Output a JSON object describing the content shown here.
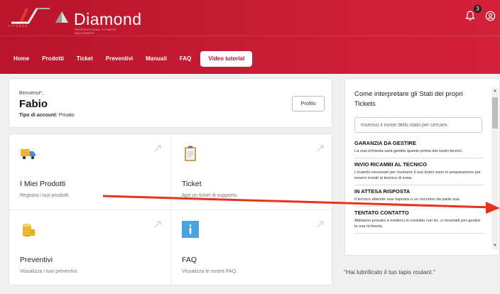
{
  "header": {
    "brand": "Diamond",
    "brand_sub": "PROFESSIONAL FITNESS EQUIPMENT",
    "logo_text": "FITNESS",
    "notifications_count": "3"
  },
  "nav": {
    "items": [
      {
        "label": "Home"
      },
      {
        "label": "Prodotti"
      },
      {
        "label": "Ticket"
      },
      {
        "label": "Preventivi"
      },
      {
        "label": "Manuali"
      },
      {
        "label": "FAQ"
      },
      {
        "label": "Video tutorial"
      }
    ],
    "active": "Video tutorial"
  },
  "welcome": {
    "greeting": "Benvenut*,",
    "name": "Fabio",
    "account_type_label": "Tipo di account:",
    "account_type_value": "Privato",
    "profile_button": "Profilo"
  },
  "tiles": [
    {
      "title": "I Miei Prodotti",
      "desc": "Registra i tuoi prodotti.",
      "icon": "truck-icon"
    },
    {
      "title": "Ticket",
      "desc": "Apri un ticket di supporto.",
      "icon": "clipboard-icon"
    },
    {
      "title": "Preventivi",
      "desc": "Visualizza i tuoi preventivi.",
      "icon": "coins-icon"
    },
    {
      "title": "FAQ",
      "desc": "Visualizza le nostre FAQ.",
      "icon": "info-icon"
    }
  ],
  "sidebar": {
    "title": "Come interpretare gli Stati dei propri Tickets",
    "search_placeholder": "Inserisci il nome dello stato per cercare.",
    "statuses": [
      {
        "title": "GARANZIA DA GESTIRE",
        "desc": "La sua richiesta sarà gestita quanto prima dai nostri tecnici."
      },
      {
        "title": "INVIO RICAMBI AL TECNICO",
        "desc": "I ricambi necessari per risolvere il suo ticket sono in preparazione per essere inviati al tecnico di zona."
      },
      {
        "title": "IN ATTESA RISPOSTA",
        "desc": "Il tecnico attende una risposta o un riscontro da parte sua."
      },
      {
        "title": "TENTATO CONTATTO",
        "desc": "Abbiamo provato a metterci in contatto con lei, ci ricontatti per gestire la sua richiesta."
      }
    ]
  },
  "quote": "\"Hai lubrificato il tuo tapis roulant.\"",
  "colors": {
    "brand_red": "#c51c33",
    "annotation_arrow": "#e8321e",
    "info_blue": "#4aa3df"
  }
}
